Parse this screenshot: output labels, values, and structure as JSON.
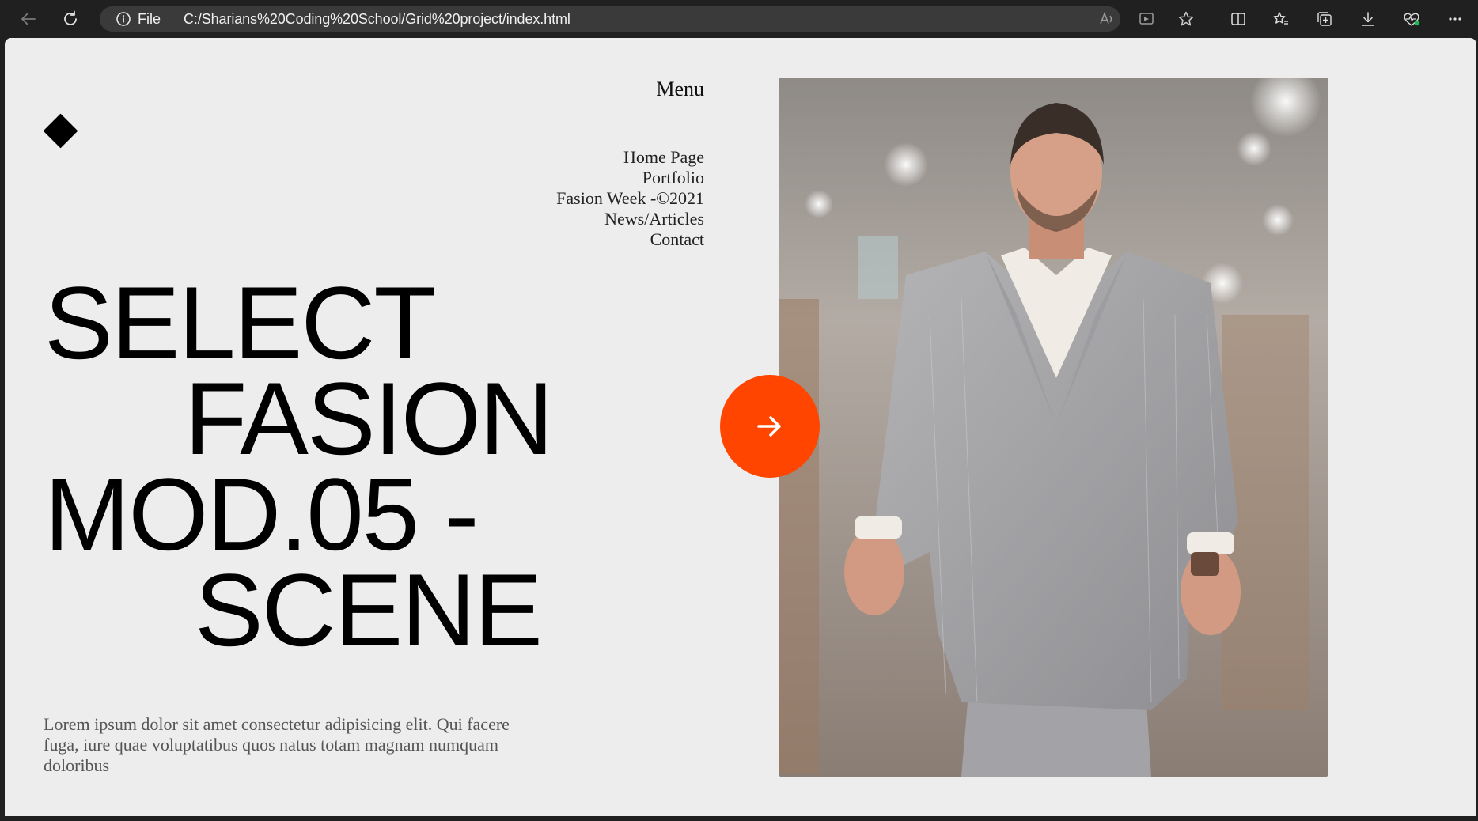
{
  "browser": {
    "file_label": "File",
    "url": "C:/Sharians%20Coding%20School/Grid%20project/index.html"
  },
  "site": {
    "menu_title": "Menu",
    "nav": [
      "Home Page",
      "Portfolio",
      "Fasion Week -©2021",
      "News/Articles",
      "Contact"
    ],
    "headline": [
      "SELECT",
      "FASION",
      "MOD.05 -",
      "SCENE"
    ],
    "body_text": "Lorem ipsum dolor sit amet consectetur adipisicing elit. Qui facere fuga, iure quae voluptatibus quos natus totam magnam numquam doloribus",
    "accent_color": "#ff4500",
    "photo_subject": "man in grey pinstripe suit walking"
  }
}
